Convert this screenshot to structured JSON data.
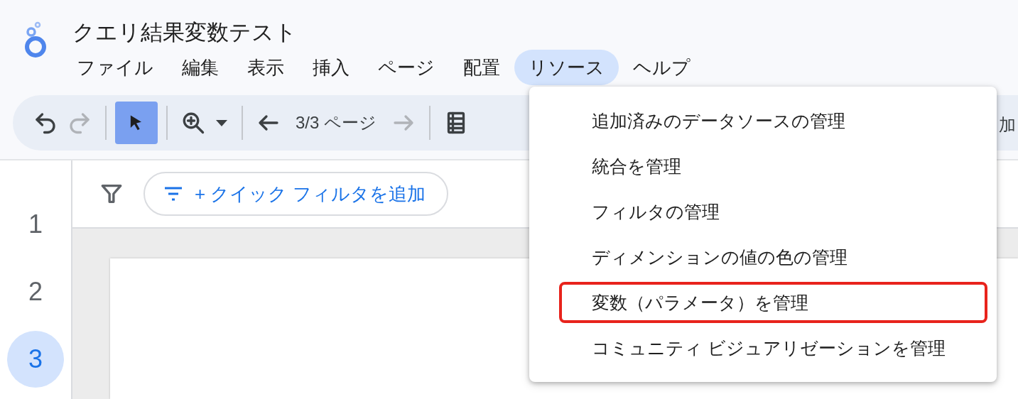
{
  "document": {
    "title": "クエリ結果変数テスト"
  },
  "menu_bar": [
    {
      "label": "ファイル",
      "selected": false
    },
    {
      "label": "編集",
      "selected": false
    },
    {
      "label": "表示",
      "selected": false
    },
    {
      "label": "挿入",
      "selected": false
    },
    {
      "label": "ページ",
      "selected": false
    },
    {
      "label": "配置",
      "selected": false
    },
    {
      "label": "リソース",
      "selected": true
    },
    {
      "label": "ヘルプ",
      "selected": false
    }
  ],
  "toolbar": {
    "redo_disabled": true,
    "select_active": true,
    "page_indicator": "3/3 ページ",
    "next_disabled": true,
    "cut_label": "加"
  },
  "filter_bar": {
    "quick_filter_button": "+ クイック フィルタを追加"
  },
  "pages": [
    {
      "label": "1",
      "selected": false
    },
    {
      "label": "2",
      "selected": false
    },
    {
      "label": "3",
      "selected": true
    }
  ],
  "resource_menu": [
    {
      "label": "追加済みのデータソースの管理",
      "highlighted": false
    },
    {
      "label": "統合を管理",
      "highlighted": false
    },
    {
      "label": "フィルタの管理",
      "highlighted": false
    },
    {
      "label": "ディメンションの値の色の管理",
      "highlighted": false
    },
    {
      "label": "変数（パラメータ）を管理",
      "highlighted": true
    },
    {
      "label": "コミュニティ ビジュアリゼーションを管理",
      "highlighted": false
    }
  ]
}
